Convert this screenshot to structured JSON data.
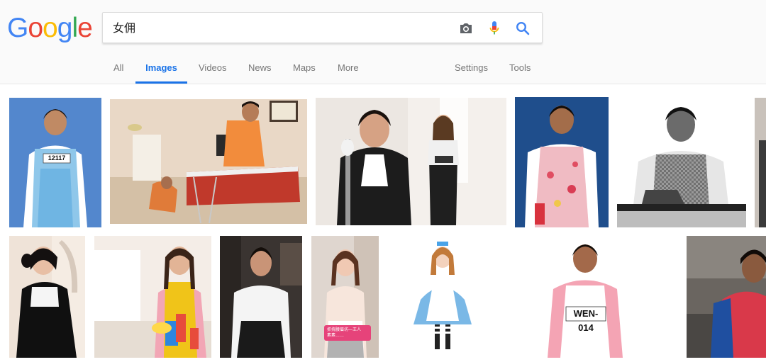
{
  "logo": {
    "letters": [
      {
        "char": "G",
        "color": "#4285f4"
      },
      {
        "char": "o",
        "color": "#ea4335"
      },
      {
        "char": "o",
        "color": "#fbbc05"
      },
      {
        "char": "g",
        "color": "#4285f4"
      },
      {
        "char": "l",
        "color": "#34a853"
      },
      {
        "char": "e",
        "color": "#ea4335"
      }
    ]
  },
  "search": {
    "query": "女佣",
    "camera_icon": "camera-icon",
    "mic_icon": "microphone-icon",
    "search_icon": "search-icon"
  },
  "tabs": {
    "all": "All",
    "images": "Images",
    "videos": "Videos",
    "news": "News",
    "maps": "Maps",
    "more": "More",
    "settings": "Settings",
    "tools": "Tools"
  },
  "results": {
    "badge_1": "12117",
    "badge_2": "WEN-014",
    "pink_caption_1": "抓挠腰眉坊—王人",
    "pink_caption_2": "素素……"
  },
  "colors": {
    "accent": "#1a73e8",
    "tab_text": "#777777"
  }
}
